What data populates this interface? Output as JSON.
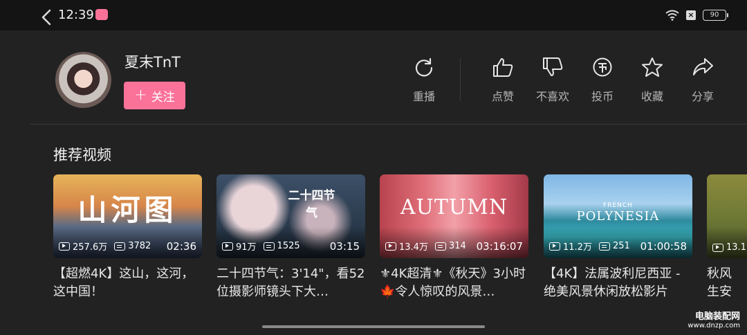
{
  "status_bar": {
    "time": "12:39",
    "battery": "90"
  },
  "uploader": {
    "name": "夏末TnT",
    "follow_label": "关注",
    "follow_plus": "+"
  },
  "actions": [
    {
      "id": "replay",
      "label": "重播"
    },
    {
      "id": "like",
      "label": "点赞"
    },
    {
      "id": "dislike",
      "label": "不喜欢"
    },
    {
      "id": "coin",
      "label": "投币"
    },
    {
      "id": "favorite",
      "label": "收藏"
    },
    {
      "id": "share",
      "label": "分享"
    }
  ],
  "section_title": "推荐视频",
  "videos": [
    {
      "thumb_text": "山河图",
      "views": "257.6万",
      "danmaku": "3782",
      "duration": "02:36",
      "title": "【超燃4K】这山，这河，这中国！"
    },
    {
      "thumb_text": "二十四节气",
      "views": "91万",
      "danmaku": "1525",
      "duration": "03:15",
      "title": "二十四节气：3'14\"，看52位摄影师镜头下大…"
    },
    {
      "thumb_text": "AUTUMN",
      "views": "13.4万",
      "danmaku": "314",
      "duration": "03:16:07",
      "title": "⚜4K超清⚜《秋天》3小时🍁令人惊叹的风景…"
    },
    {
      "thumb_text": "POLYNESIA",
      "thumb_small": "FRENCH",
      "views": "11.2万",
      "danmaku": "251",
      "duration": "01:00:58",
      "title": "【4K】法属波利尼西亚 - 绝美风景休闲放松影片"
    },
    {
      "views": "13.1",
      "title": "秋风生安"
    }
  ],
  "watermark": {
    "title": "电脑装配网",
    "url": "www.dnzp.com"
  },
  "colors": {
    "accent": "#fb7299",
    "background": "#222222"
  },
  "icons": [
    "back-chevron-icon",
    "wifi-icon",
    "replay-icon",
    "thumbs-up-icon",
    "thumbs-down-icon",
    "coin-icon",
    "star-icon",
    "share-icon",
    "play-count-icon",
    "danmaku-icon"
  ]
}
